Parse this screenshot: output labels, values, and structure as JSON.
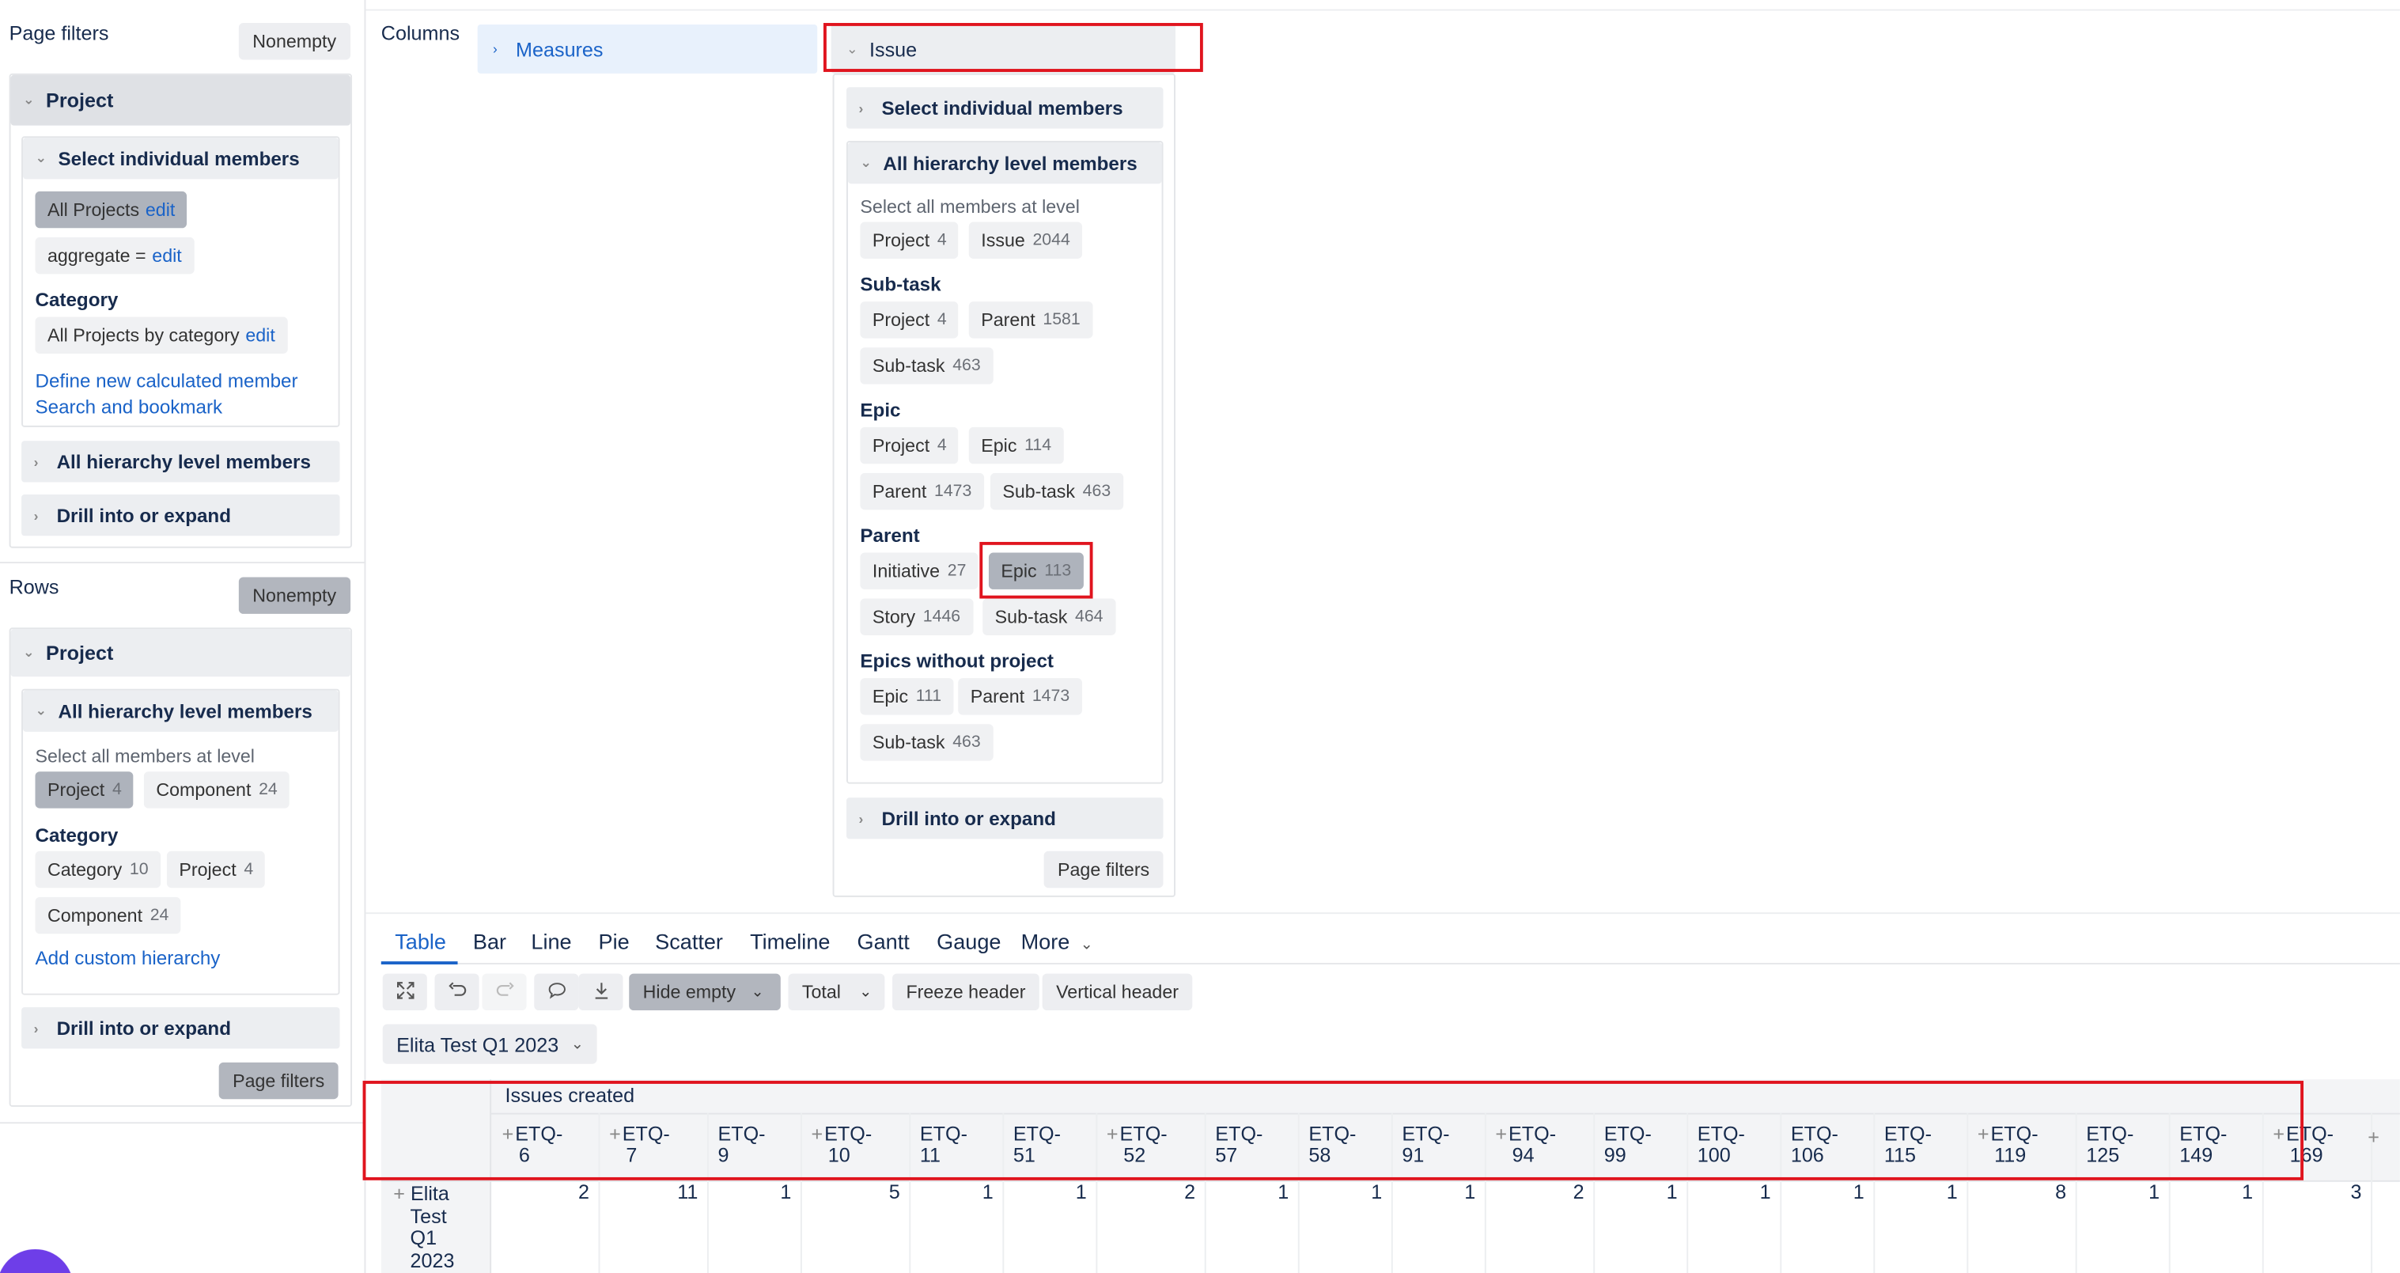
{
  "left": {
    "page_filters": {
      "title": "Page filters",
      "nonempty": "Nonempty",
      "project_header": "Project",
      "select_individual": "Select individual members",
      "chip_all_projects": "All Projects",
      "chip_all_projects_edit": "edit",
      "chip_aggregate": "aggregate =",
      "chip_aggregate_edit": "edit",
      "category_label": "Category",
      "chip_by_category": "All Projects by category",
      "chip_by_category_edit": "edit",
      "define_new": "Define new calculated member",
      "search_bookmark": "Search and bookmark",
      "all_hierarchy": "All hierarchy level members",
      "drill": "Drill into or expand"
    },
    "rows": {
      "title": "Rows",
      "nonempty": "Nonempty",
      "project_header": "Project",
      "all_hierarchy": "All hierarchy level members",
      "select_all_level": "Select all members at level",
      "chip_project": "Project",
      "chip_project_cnt": "4",
      "chip_component": "Component",
      "chip_component_cnt": "24",
      "category_label": "Category",
      "chip_category": "Category",
      "chip_category_cnt": "10",
      "chip_project2": "Project",
      "chip_project2_cnt": "4",
      "chip_component2": "Component",
      "chip_component2_cnt": "24",
      "add_custom": "Add custom hierarchy",
      "drill": "Drill into or expand",
      "page_filters_btn": "Page filters"
    }
  },
  "columns": {
    "title": "Columns",
    "measures": "Measures",
    "issue": "Issue",
    "select_individual": "Select individual members",
    "all_hierarchy": "All hierarchy level members",
    "select_all_level": "Select all members at level",
    "top_chips": [
      {
        "label": "Project",
        "cnt": "4"
      },
      {
        "label": "Issue",
        "cnt": "2044"
      }
    ],
    "subtask_label": "Sub-task",
    "subtask_chips": [
      {
        "label": "Project",
        "cnt": "4"
      },
      {
        "label": "Parent",
        "cnt": "1581"
      },
      {
        "label": "Sub-task",
        "cnt": "463"
      }
    ],
    "epic_label": "Epic",
    "epic_chips": [
      {
        "label": "Project",
        "cnt": "4"
      },
      {
        "label": "Epic",
        "cnt": "114"
      },
      {
        "label": "Parent",
        "cnt": "1473"
      },
      {
        "label": "Sub-task",
        "cnt": "463"
      }
    ],
    "parent_label": "Parent",
    "parent_chips": [
      {
        "label": "Initiative",
        "cnt": "27"
      },
      {
        "label": "Epic",
        "cnt": "113"
      },
      {
        "label": "Story",
        "cnt": "1446"
      },
      {
        "label": "Sub-task",
        "cnt": "464"
      }
    ],
    "ewp_label": "Epics without project",
    "ewp_chips": [
      {
        "label": "Epic",
        "cnt": "111"
      },
      {
        "label": "Parent",
        "cnt": "1473"
      },
      {
        "label": "Sub-task",
        "cnt": "463"
      }
    ],
    "drill": "Drill into or expand",
    "page_filters_btn": "Page filters"
  },
  "view": {
    "tabs": [
      "Table",
      "Bar",
      "Line",
      "Pie",
      "Scatter",
      "Timeline",
      "Gantt",
      "Gauge",
      "More"
    ],
    "active_tab": "Table",
    "toolbar": {
      "hide_empty": "Hide empty",
      "total": "Total",
      "freeze_header": "Freeze header",
      "vertical_header": "Vertical header"
    },
    "page_filter_value": "Elita Test Q1 2023"
  },
  "table": {
    "measure_header": "Issues created",
    "columns": [
      {
        "l1": "ETQ-",
        "l2": "6",
        "v": "2",
        "plus": true
      },
      {
        "l1": "ETQ-",
        "l2": "7",
        "v": "11",
        "plus": true
      },
      {
        "l1": "ETQ-",
        "l2": "9",
        "v": "1",
        "plus": false
      },
      {
        "l1": "ETQ-",
        "l2": "10",
        "v": "5",
        "plus": true
      },
      {
        "l1": "ETQ-",
        "l2": "11",
        "v": "1",
        "plus": false
      },
      {
        "l1": "ETQ-",
        "l2": "51",
        "v": "1",
        "plus": false
      },
      {
        "l1": "ETQ-",
        "l2": "52",
        "v": "2",
        "plus": true
      },
      {
        "l1": "ETQ-",
        "l2": "57",
        "v": "1",
        "plus": false
      },
      {
        "l1": "ETQ-",
        "l2": "58",
        "v": "1",
        "plus": false
      },
      {
        "l1": "ETQ-",
        "l2": "91",
        "v": "1",
        "plus": false
      },
      {
        "l1": "ETQ-",
        "l2": "94",
        "v": "2",
        "plus": true
      },
      {
        "l1": "ETQ-",
        "l2": "99",
        "v": "1",
        "plus": false
      },
      {
        "l1": "ETQ-",
        "l2": "100",
        "v": "1",
        "plus": false
      },
      {
        "l1": "ETQ-",
        "l2": "106",
        "v": "1",
        "plus": false
      },
      {
        "l1": "ETQ-",
        "l2": "115",
        "v": "1",
        "plus": false
      },
      {
        "l1": "ETQ-",
        "l2": "119",
        "v": "8",
        "plus": true
      },
      {
        "l1": "ETQ-",
        "l2": "125",
        "v": "1",
        "plus": false
      },
      {
        "l1": "ETQ-",
        "l2": "149",
        "v": "1",
        "plus": false
      },
      {
        "l1": "ETQ-",
        "l2": "169",
        "v": "3",
        "plus": true
      }
    ],
    "row_label_lines": [
      "Elita",
      "Test",
      "Q1",
      "2023"
    ]
  }
}
